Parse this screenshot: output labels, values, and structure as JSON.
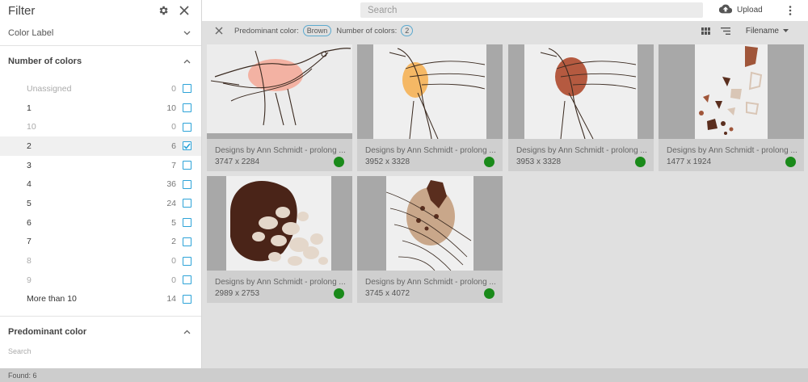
{
  "sidebar": {
    "title": "Filter",
    "color_label": "Color Label",
    "number_of_colors": "Number of colors",
    "options": [
      {
        "label": "Unassigned",
        "count": "0",
        "dim": true,
        "checked": false
      },
      {
        "label": "1",
        "count": "10",
        "dim": false,
        "checked": false
      },
      {
        "label": "10",
        "count": "0",
        "dim": true,
        "checked": false
      },
      {
        "label": "2",
        "count": "6",
        "dim": false,
        "checked": true
      },
      {
        "label": "3",
        "count": "7",
        "dim": false,
        "checked": false
      },
      {
        "label": "4",
        "count": "36",
        "dim": false,
        "checked": false
      },
      {
        "label": "5",
        "count": "24",
        "dim": false,
        "checked": false
      },
      {
        "label": "6",
        "count": "5",
        "dim": false,
        "checked": false
      },
      {
        "label": "7",
        "count": "2",
        "dim": false,
        "checked": false
      },
      {
        "label": "8",
        "count": "0",
        "dim": true,
        "checked": false
      },
      {
        "label": "9",
        "count": "0",
        "dim": true,
        "checked": false
      },
      {
        "label": "More than 10",
        "count": "14",
        "dim": false,
        "checked": false
      }
    ],
    "predominant_color": "Predominant color",
    "search_placeholder": "Search"
  },
  "topbar": {
    "search_placeholder": "Search",
    "upload_label": "Upload"
  },
  "chipbar": {
    "predominant_label": "Predominant color:",
    "predominant_value": "Brown",
    "number_label": "Number of colors:",
    "number_value": "2",
    "sort_label": "Filename"
  },
  "cards": [
    {
      "name": "Designs by Ann Schmidt - prolong ...",
      "size": "3747 x 2284"
    },
    {
      "name": "Designs by Ann Schmidt - prolong ...",
      "size": "3952 x 3328"
    },
    {
      "name": "Designs by Ann Schmidt - prolong ...",
      "size": "3953 x 3328"
    },
    {
      "name": "Designs by Ann Schmidt - prolong ...",
      "size": "1477 x 1924"
    },
    {
      "name": "Designs by Ann Schmidt - prolong ...",
      "size": "2989 x 2753"
    },
    {
      "name": "Designs by Ann Schmidt - prolong ...",
      "size": "3745 x 4072"
    }
  ],
  "colors": {
    "accent": "#2da3d8",
    "status_green": "#1a8a1a"
  },
  "footer": {
    "found": "Found: 6"
  }
}
